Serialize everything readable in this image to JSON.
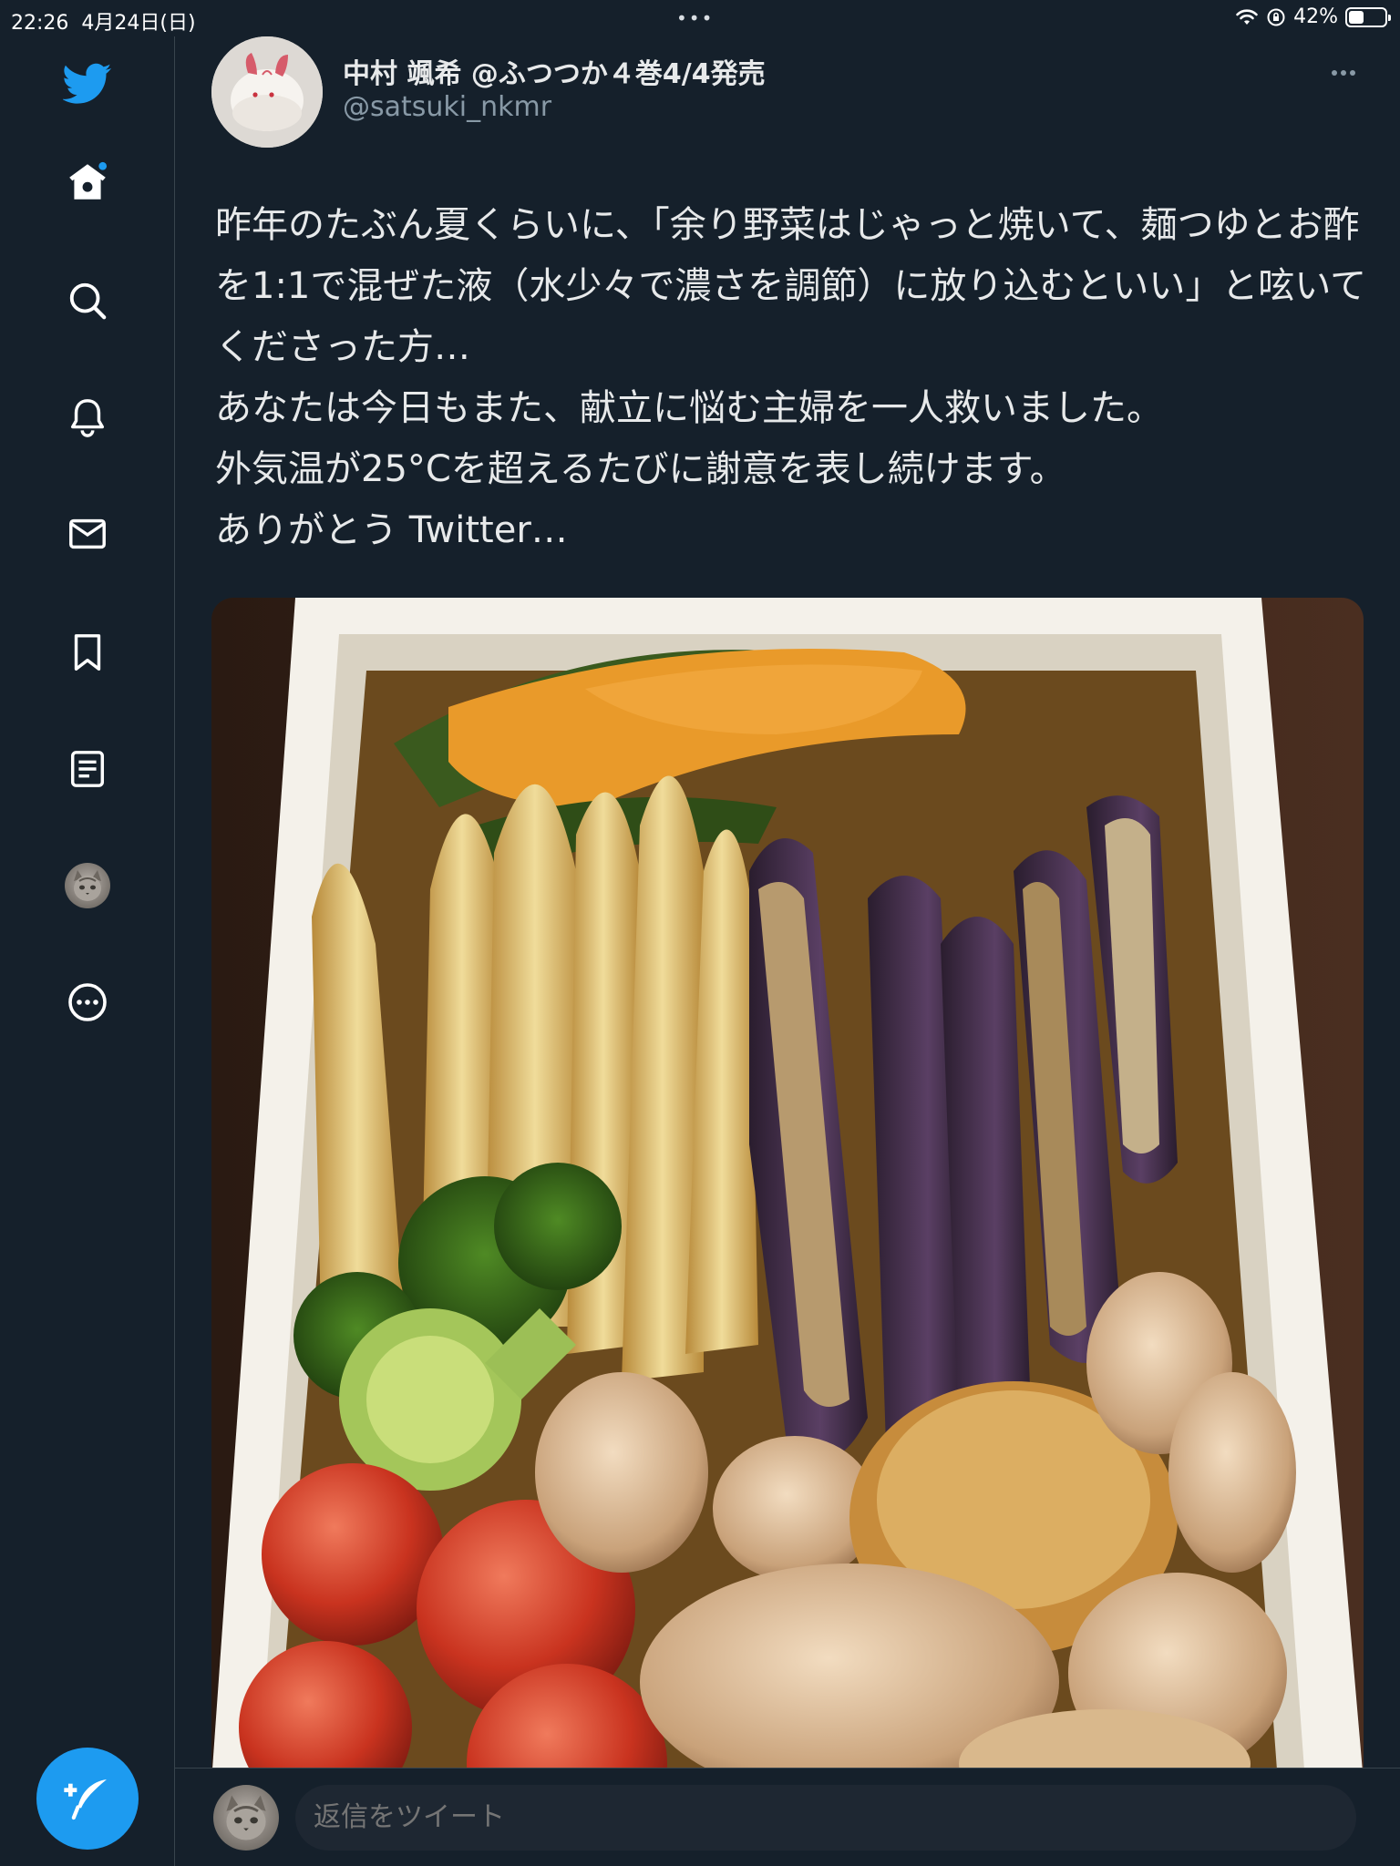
{
  "status_bar": {
    "time": "22:26",
    "date": "4月24日(日)",
    "dots": "•••",
    "battery_pct": "42%",
    "battery_level": 0.42
  },
  "sidebar": {
    "items": [
      {
        "icon": "twitter-logo-icon"
      },
      {
        "icon": "home-icon"
      },
      {
        "icon": "search-icon"
      },
      {
        "icon": "bell-icon"
      },
      {
        "icon": "mail-icon"
      },
      {
        "icon": "bookmark-icon"
      },
      {
        "icon": "list-icon"
      },
      {
        "icon": "profile-avatar"
      },
      {
        "icon": "more-circle-icon"
      }
    ],
    "compose_icon": "compose-tweet-icon"
  },
  "tweet": {
    "display_name": "中村 颯希 @ふつつか４巻4/4発売",
    "handle": "@satsuki_nkmr",
    "text": "昨年のたぶん夏くらいに、「余り野菜はじゃっと焼いて、麺つゆとお酢を1:1で混ぜた液（水少々で濃さを調節）に放り込むといい」と呟いてくださった方…\nあなたは今日もまた、献立に悩む主婦を一人救いました。\n外気温が25°Cを超えるたびに謝意を表し続けます。\nありがとう Twitter…"
  },
  "reply": {
    "placeholder": "返信をツイート"
  },
  "colors": {
    "background": "#15202b",
    "accent": "#1d9bf0",
    "secondary_text": "#8899a6"
  }
}
